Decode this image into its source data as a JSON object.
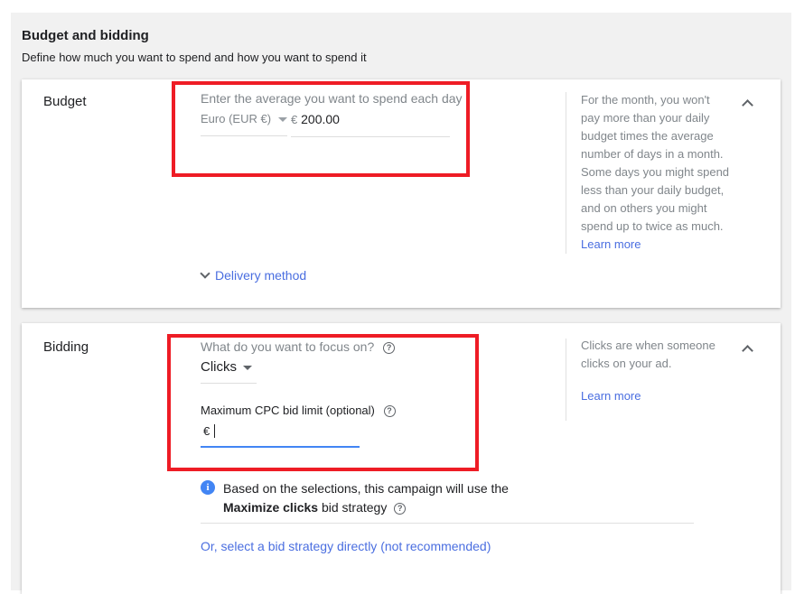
{
  "section": {
    "title": "Budget and bidding",
    "subtitle": "Define how much you want to spend and how you want to spend it"
  },
  "budget": {
    "label": "Budget",
    "field_label": "Enter the average you want to spend each day",
    "currency": "Euro (EUR €)",
    "currency_symbol": "€",
    "amount": "200.00",
    "help": "For the month, you won't pay more than your daily budget times the average number of days in a month. Some days you might spend less than your daily budget, and on others you might spend up to twice as much.",
    "learn_more": "Learn more",
    "delivery_method": "Delivery method"
  },
  "bidding": {
    "label": "Bidding",
    "focus_label": "What do you want to focus on?",
    "focus_value": "Clicks",
    "cpc_label": "Maximum CPC bid limit (optional)",
    "cpc_symbol": "€",
    "cpc_value": "",
    "info_prefix": "Based on the selections, this campaign will use the",
    "info_strategy": "Maximize clicks",
    "info_suffix": "bid strategy",
    "select_strategy": "Or, select a bid strategy directly (not recommended)",
    "help": "Clicks are when someone clicks on your ad.",
    "learn_more": "Learn more"
  },
  "colors": {
    "highlight": "#ee1c25",
    "link": "#4a6ee0",
    "info": "#4285f4"
  }
}
